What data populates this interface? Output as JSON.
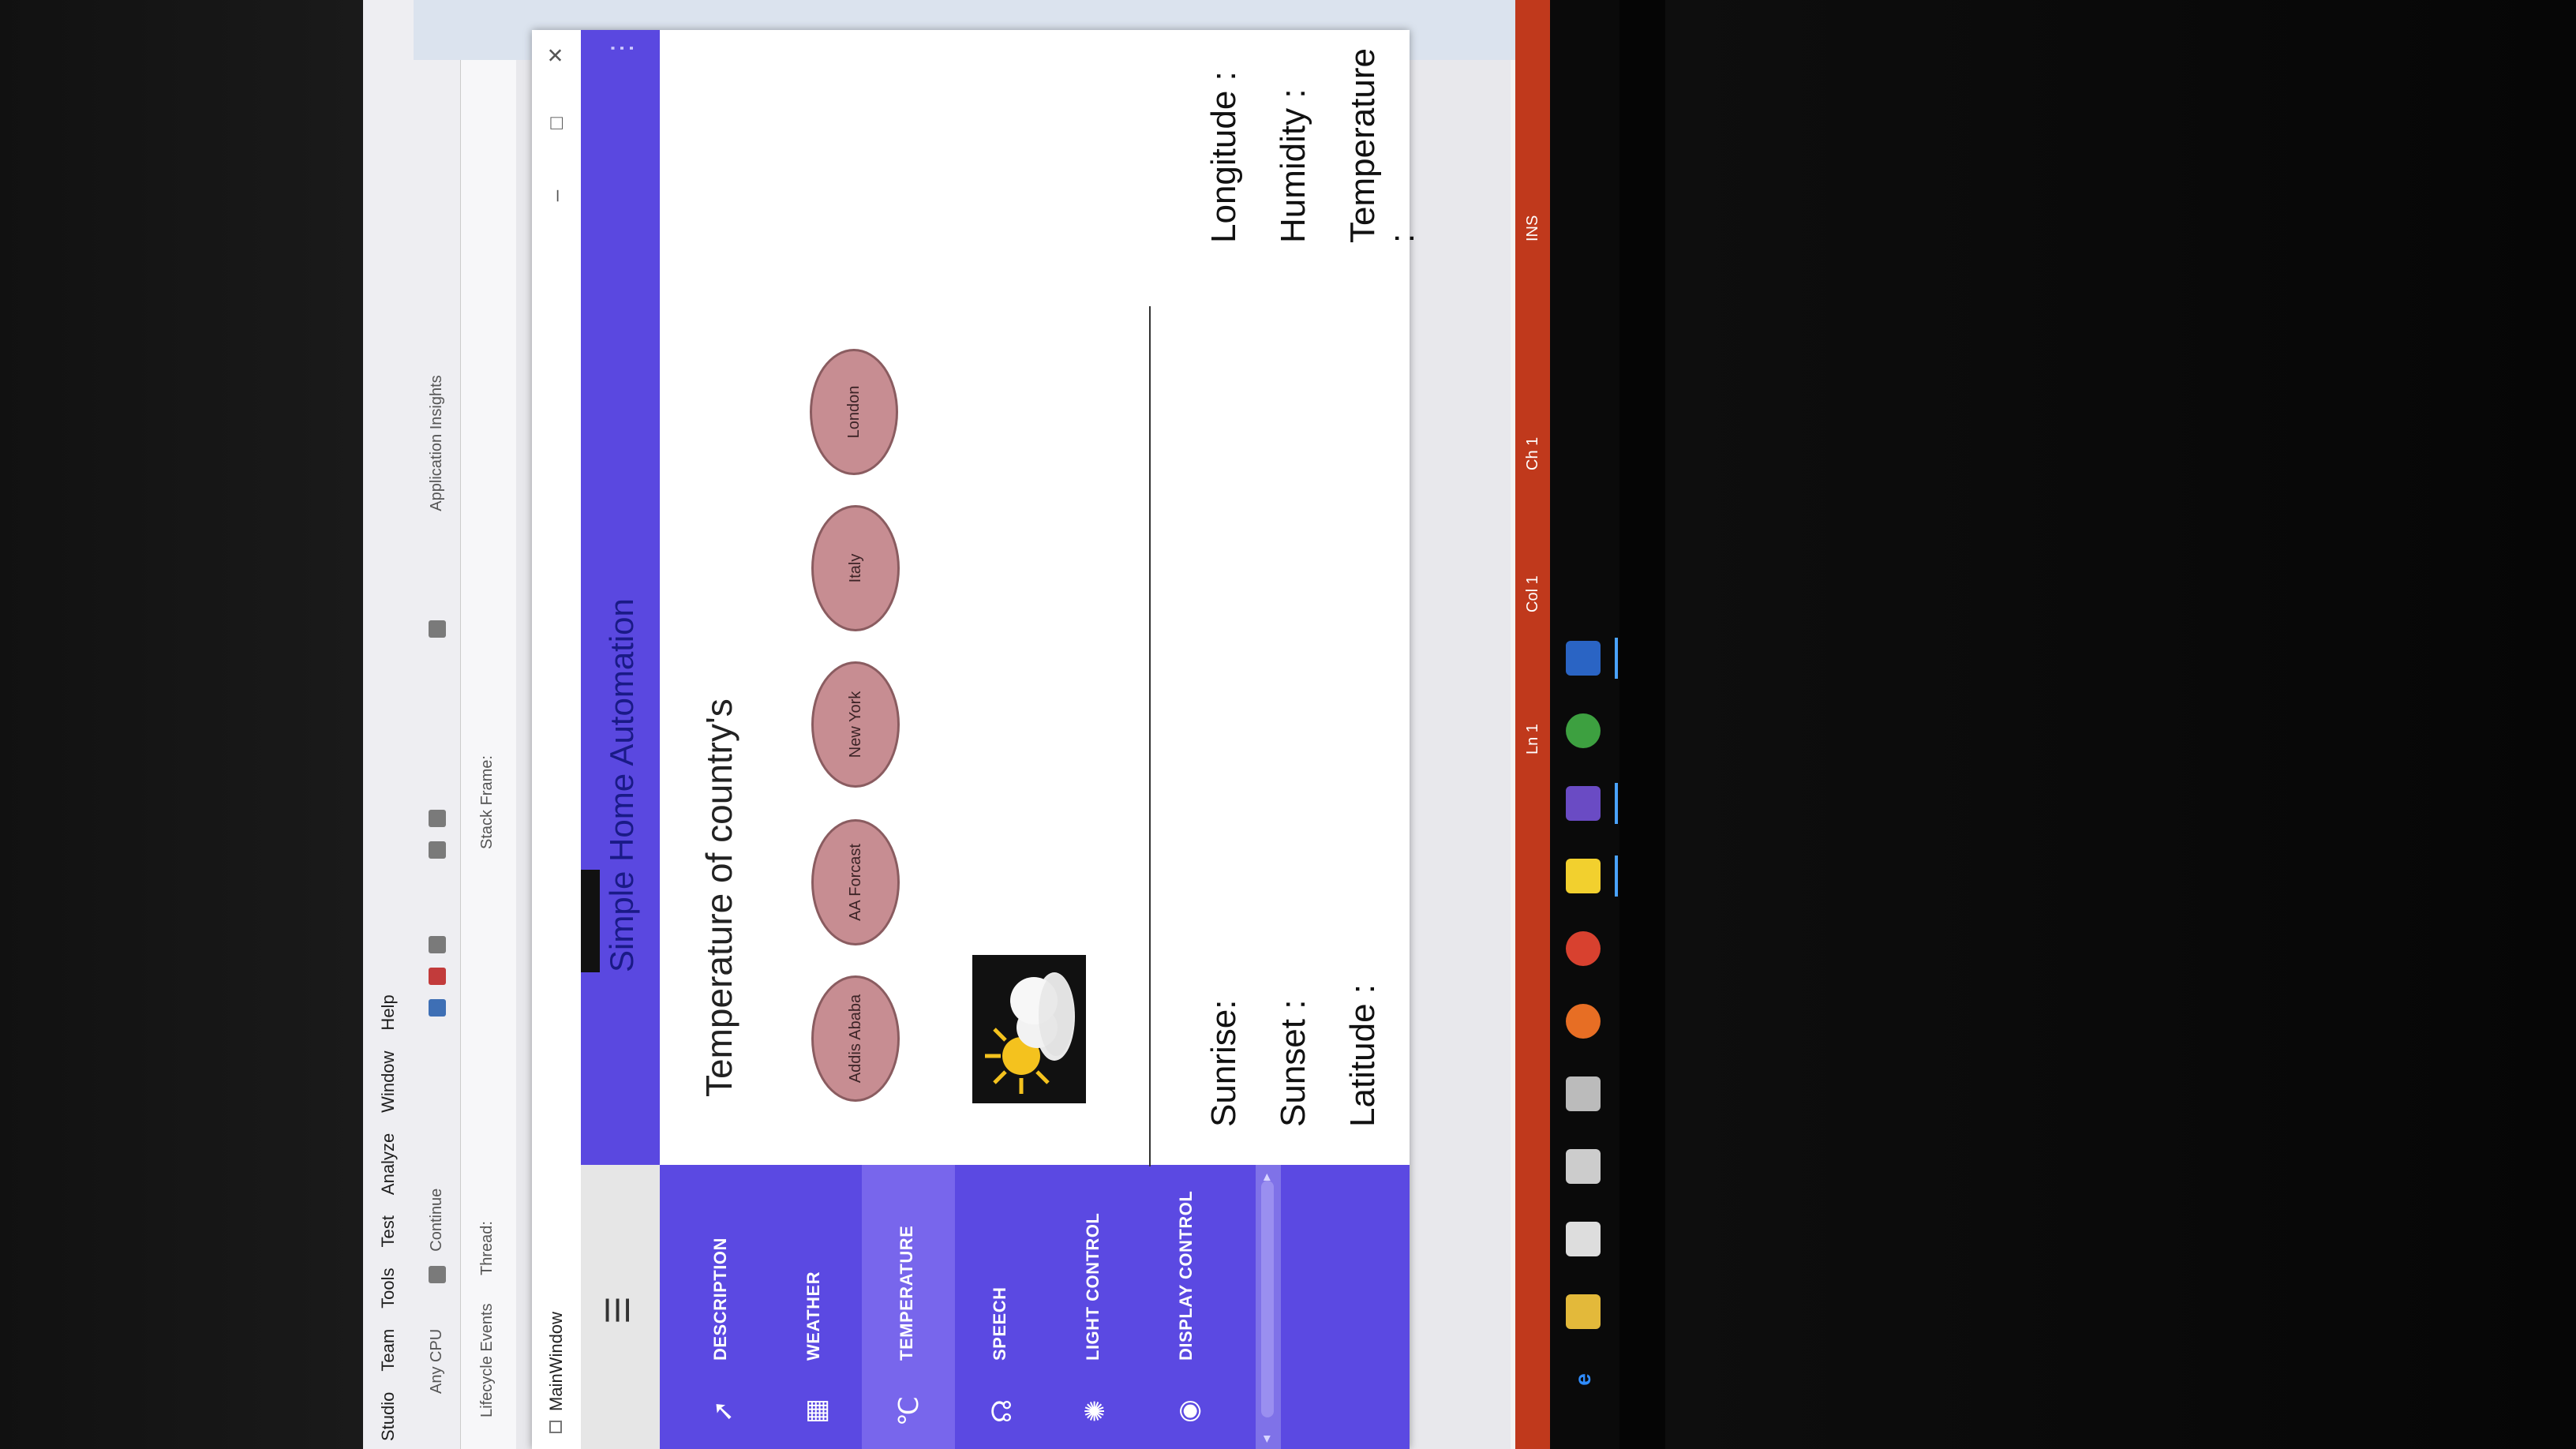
{
  "vs": {
    "menu": [
      "Studio",
      "Team",
      "Tools",
      "Test",
      "Analyze",
      "Window",
      "Help"
    ],
    "toolbar": {
      "config": "Any CPU",
      "continue": "Continue",
      "lifecycle": "Lifecycle Events",
      "thread": "Thread:",
      "stack_frame": "Stack Frame:",
      "insights": "Application Insights"
    },
    "status": {
      "ln": "Ln 1",
      "col": "Col 1",
      "ch": "Ch 1",
      "ins": "INS"
    }
  },
  "window": {
    "title": "MainWindow",
    "minimize": "–",
    "maximize": "□",
    "close": "✕"
  },
  "app": {
    "title": "Simple Home Automation",
    "menu_glyph": "☰",
    "more_glyph": "⋮",
    "nav": [
      {
        "icon": "compass-icon",
        "glyph": "➚",
        "label": "DESCRIPTION",
        "selected": false
      },
      {
        "icon": "windows-icon",
        "glyph": "▦",
        "label": "WEATHER",
        "selected": false
      },
      {
        "icon": "celsius-icon",
        "glyph": "℃",
        "label": "TEMPERATURE",
        "selected": true
      },
      {
        "icon": "speech-icon",
        "glyph": "☊",
        "label": "SPEECH",
        "selected": false
      },
      {
        "icon": "lightbulb-icon",
        "glyph": "✺",
        "label": "LIGHT CONTROL",
        "selected": false
      },
      {
        "icon": "eye-icon",
        "glyph": "◉",
        "label": "DISPLAY CONTROL",
        "selected": false
      }
    ],
    "heading": "Temperature of country's",
    "cities": [
      "Addis Ababa",
      "AA Forcast",
      "New York",
      "Italy",
      "London"
    ],
    "labels": {
      "sunrise": "Sunrise:",
      "sunset": "Sunset :",
      "latitude": "Latitude :",
      "longitude": "Longitude :",
      "humidity": "Humidity :",
      "temperature": "Temperature :"
    },
    "weather_icon": "partly-cloudy-icon",
    "colors": {
      "accent": "#5a48e0",
      "selected": "#7866ec",
      "city_button": "#c78d92"
    }
  }
}
